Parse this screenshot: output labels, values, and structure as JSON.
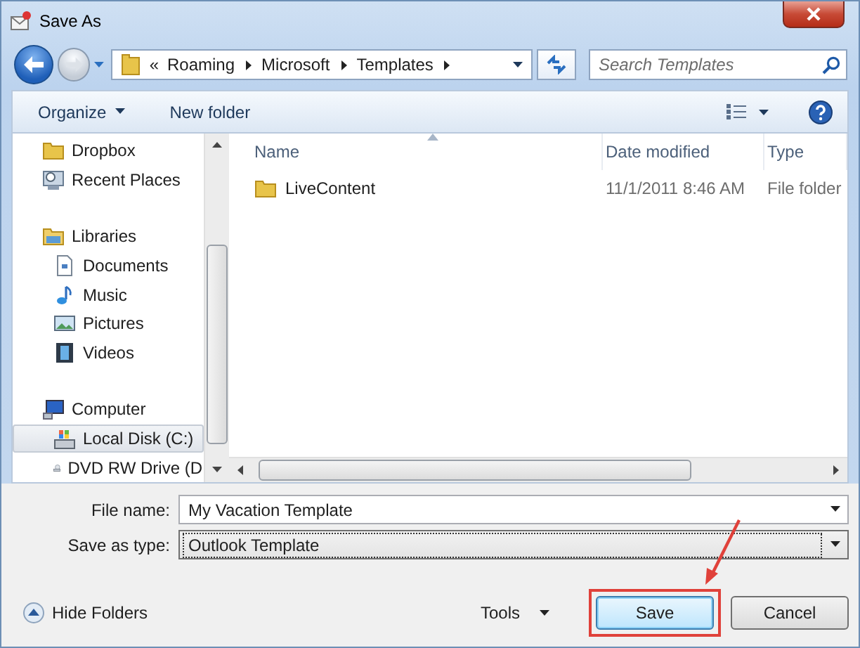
{
  "window": {
    "title": "Save As"
  },
  "address": {
    "overflow": "«",
    "path": [
      "Roaming",
      "Microsoft",
      "Templates"
    ]
  },
  "search": {
    "placeholder": "Search Templates"
  },
  "toolbar": {
    "buttons": [
      {
        "label": "Organize",
        "menu": true
      },
      {
        "label": "New folder",
        "menu": false
      }
    ]
  },
  "navigation": {
    "items": [
      {
        "label": "Dropbox",
        "kind": "folder",
        "selected": false
      },
      {
        "label": "Recent Places",
        "kind": "recent",
        "selected": false
      },
      {
        "label": "Libraries",
        "kind": "library",
        "selected": false,
        "children": [
          {
            "label": "Documents",
            "kind": "document",
            "selected": false
          },
          {
            "label": "Music",
            "kind": "music",
            "selected": false
          },
          {
            "label": "Pictures",
            "kind": "pictures",
            "selected": false
          },
          {
            "label": "Videos",
            "kind": "videos",
            "selected": false
          }
        ]
      },
      {
        "label": "Computer",
        "kind": "computer",
        "selected": false,
        "children": [
          {
            "label": "Local Disk  (C:)",
            "kind": "disk",
            "selected": true
          },
          {
            "label": "DVD RW Drive (D",
            "kind": "dvd",
            "selected": false
          }
        ]
      }
    ]
  },
  "file_list": {
    "columns": [
      {
        "label": "Name",
        "sorted": true
      },
      {
        "label": "Date modified",
        "sorted": false
      },
      {
        "label": "Type",
        "sorted": false
      }
    ],
    "rows": [
      {
        "name": "LiveContent",
        "date_modified": "11/1/2011 8:46 AM",
        "type": "File folder",
        "selected": false
      }
    ]
  },
  "fields": [
    {
      "label": "File name:",
      "value": "My Vacation Template",
      "kind": "combo"
    },
    {
      "label": "Save as type:",
      "value": "Outlook Template",
      "kind": "select"
    }
  ],
  "hide_folders": {
    "label": "Hide Folders"
  },
  "tools": {
    "label": "Tools"
  },
  "buttons": [
    {
      "label": "Save",
      "default": true,
      "highlighted": true
    },
    {
      "label": "Cancel",
      "default": false,
      "highlighted": false
    }
  ]
}
